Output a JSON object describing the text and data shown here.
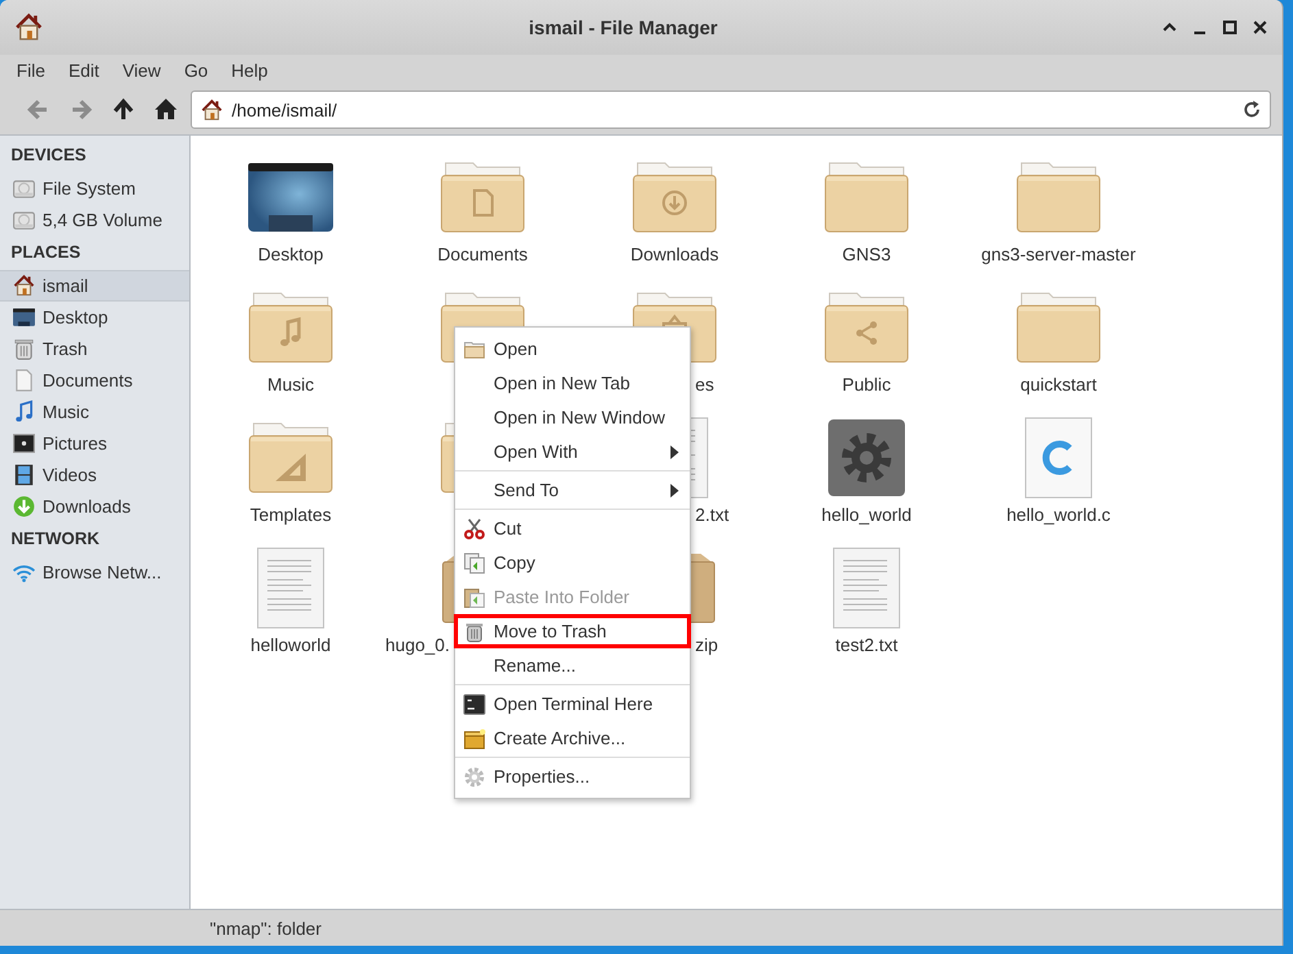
{
  "window": {
    "title": "ismail - File Manager"
  },
  "menubar": [
    "File",
    "Edit",
    "View",
    "Go",
    "Help"
  ],
  "toolbar": {
    "buttons": [
      {
        "kind": "back",
        "disabled": true
      },
      {
        "kind": "forward",
        "disabled": true
      },
      {
        "kind": "up",
        "disabled": false
      },
      {
        "kind": "home",
        "disabled": false
      }
    ],
    "location": "/home/ismail/"
  },
  "sidebar": {
    "sections": [
      {
        "title": "DEVICES",
        "items": [
          {
            "label": "File System",
            "kind": "drive",
            "selected": false
          },
          {
            "label": "5,4 GB Volume",
            "kind": "drive",
            "selected": false
          }
        ]
      },
      {
        "title": "PLACES",
        "items": [
          {
            "label": "ismail",
            "kind": "home",
            "selected": true
          },
          {
            "label": "Desktop",
            "kind": "desktop",
            "selected": false
          },
          {
            "label": "Trash",
            "kind": "trash",
            "selected": false
          },
          {
            "label": "Documents",
            "kind": "document",
            "selected": false
          },
          {
            "label": "Music",
            "kind": "music",
            "selected": false
          },
          {
            "label": "Pictures",
            "kind": "pictures",
            "selected": false
          },
          {
            "label": "Videos",
            "kind": "videos",
            "selected": false
          },
          {
            "label": "Downloads",
            "kind": "downloads",
            "selected": false
          }
        ]
      },
      {
        "title": "NETWORK",
        "items": [
          {
            "label": "Browse Netw...",
            "kind": "network",
            "selected": false
          }
        ]
      }
    ]
  },
  "files": [
    {
      "name": "Desktop",
      "kind": "desktop"
    },
    {
      "name": "Documents",
      "kind": "documents"
    },
    {
      "name": "Downloads",
      "kind": "downloads"
    },
    {
      "name": "GNS3",
      "kind": "folder"
    },
    {
      "name": "gns3-server-master",
      "kind": "folder"
    },
    {
      "name": "Music",
      "kind": "music"
    },
    {
      "kind": "folder"
    },
    {
      "name": "es",
      "kind": "pictures"
    },
    {
      "name": "Public",
      "kind": "public"
    },
    {
      "name": "quickstart",
      "kind": "folder"
    },
    {
      "name": "Templates",
      "kind": "templates"
    },
    {
      "kind": "folder"
    },
    {
      "name": "2.txt",
      "kind": "text"
    },
    {
      "name": "hello_world",
      "kind": "executable"
    },
    {
      "name": "hello_world.c",
      "kind": "csource"
    },
    {
      "name": "helloworld",
      "kind": "text"
    },
    {
      "name": "hugo_0.",
      "kind": "package"
    },
    {
      "name": "zip",
      "kind": "package"
    },
    {
      "name": "test2.txt",
      "kind": "text"
    }
  ],
  "context_menu": {
    "groups": [
      {
        "items": [
          {
            "label": "Open",
            "kind": "folder",
            "submenu": false,
            "disabled": false,
            "highlighted": false
          },
          {
            "label": "Open in New Tab",
            "kind": "none",
            "submenu": false,
            "disabled": false,
            "highlighted": false
          },
          {
            "label": "Open in New Window",
            "kind": "none",
            "submenu": false,
            "disabled": false,
            "highlighted": false
          },
          {
            "label": "Open With",
            "kind": "none",
            "submenu": true,
            "disabled": false,
            "highlighted": false
          }
        ]
      },
      {
        "items": [
          {
            "label": "Send To",
            "kind": "none",
            "submenu": true,
            "disabled": false,
            "highlighted": false
          }
        ]
      },
      {
        "items": [
          {
            "label": "Cut",
            "kind": "scissors",
            "submenu": false,
            "disabled": false,
            "highlighted": false
          },
          {
            "label": "Copy",
            "kind": "copy",
            "submenu": false,
            "disabled": false,
            "highlighted": false
          },
          {
            "label": "Paste Into Folder",
            "kind": "paste",
            "submenu": false,
            "disabled": true,
            "highlighted": false
          },
          {
            "label": "Move to Trash",
            "kind": "trash",
            "submenu": false,
            "disabled": false,
            "highlighted": true
          },
          {
            "label": "Rename...",
            "kind": "none",
            "submenu": false,
            "disabled": false,
            "highlighted": false
          }
        ]
      },
      {
        "items": [
          {
            "label": "Open Terminal Here",
            "kind": "terminal",
            "submenu": false,
            "disabled": false,
            "highlighted": false
          },
          {
            "label": "Create Archive...",
            "kind": "archive",
            "submenu": false,
            "disabled": false,
            "highlighted": false
          }
        ]
      },
      {
        "items": [
          {
            "label": "Properties...",
            "kind": "gear",
            "submenu": false,
            "disabled": false,
            "highlighted": false
          }
        ]
      }
    ]
  },
  "status_bar": "\"nmap\": folder"
}
